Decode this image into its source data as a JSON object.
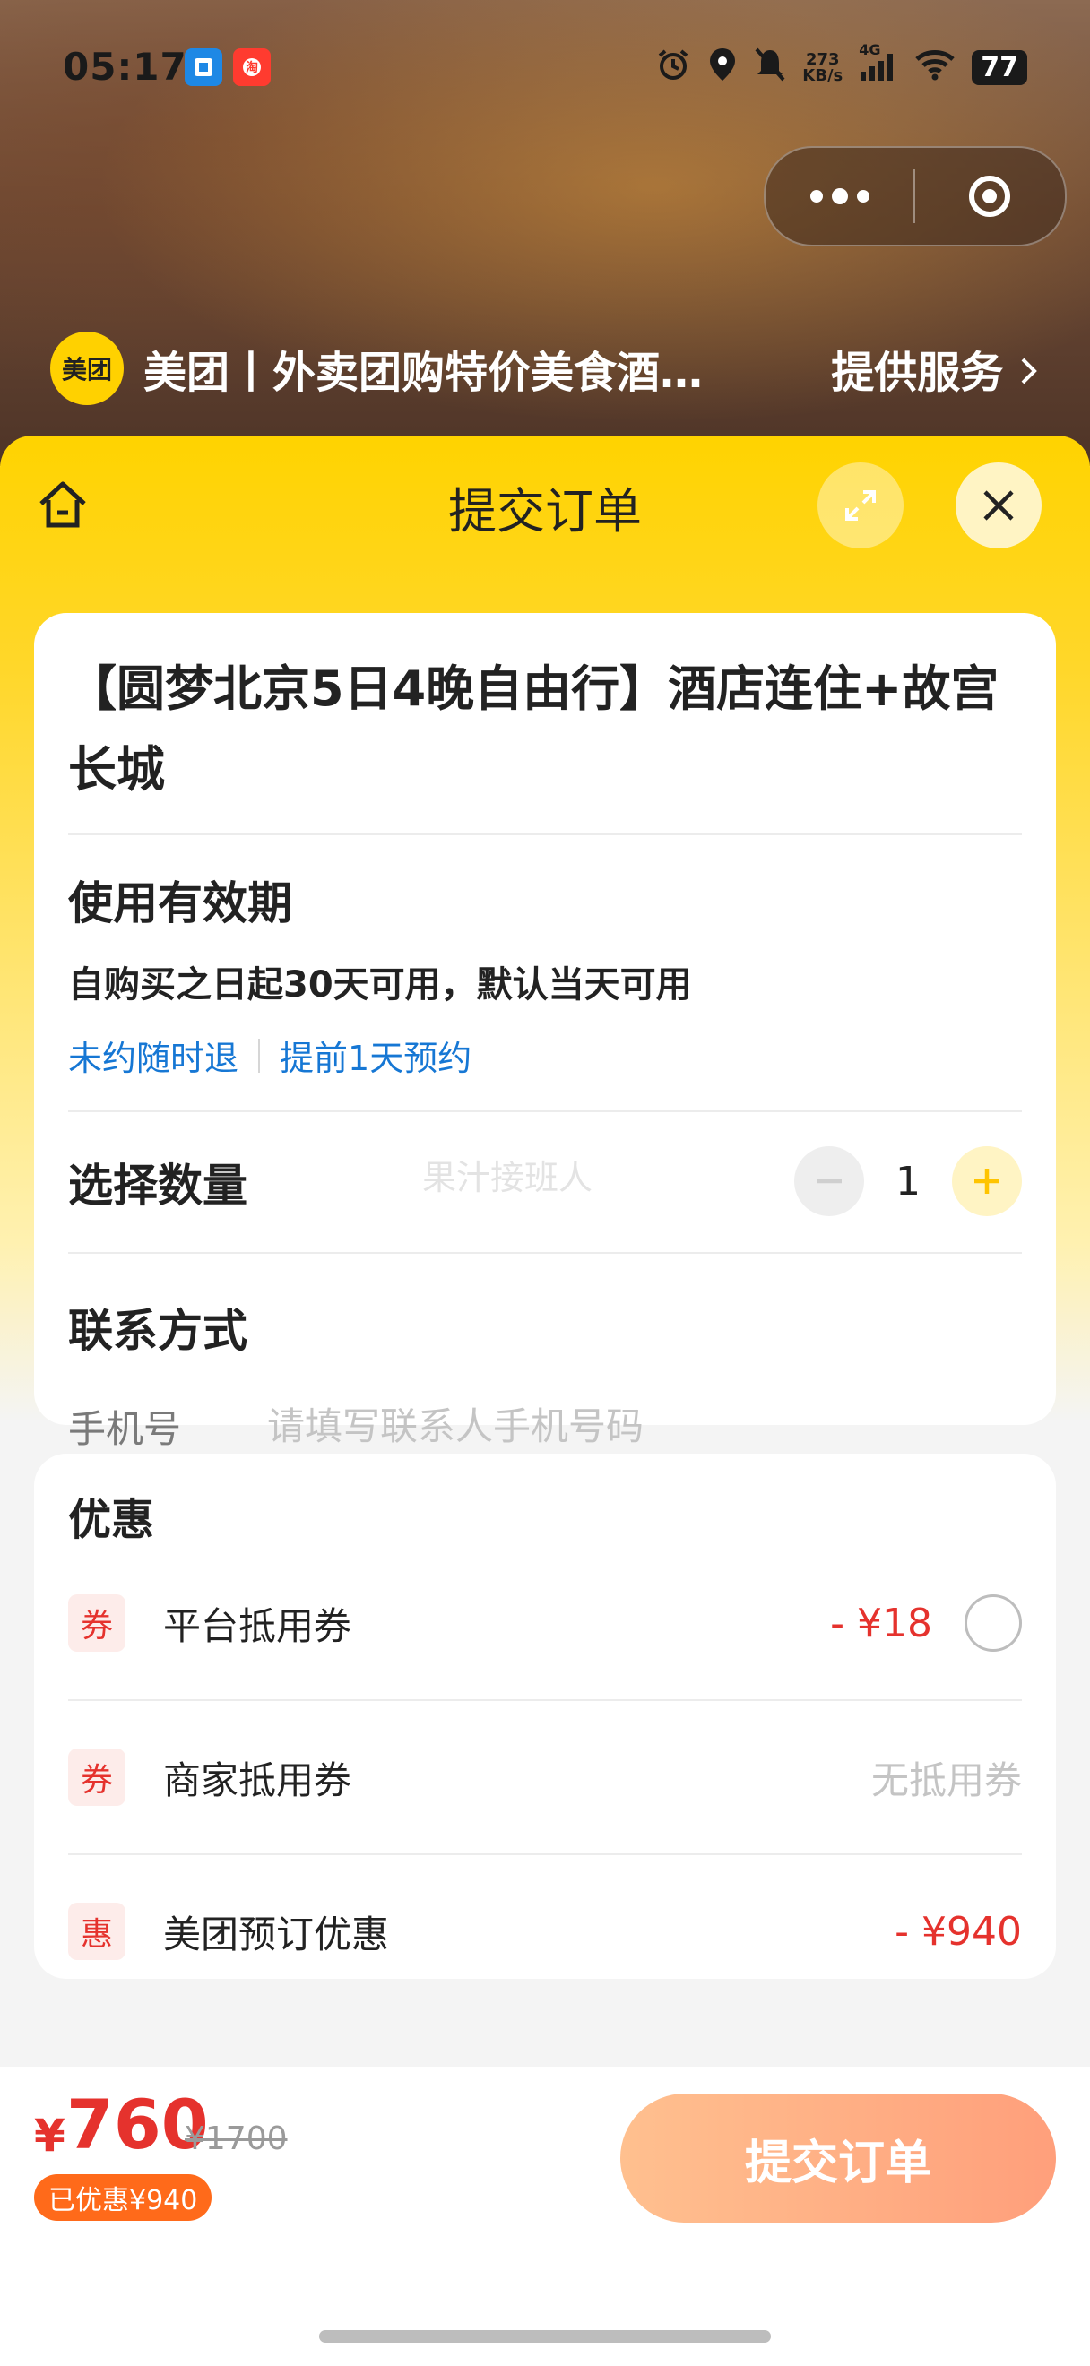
{
  "status_bar": {
    "time": "05:17",
    "net_speed_value": "273",
    "net_speed_unit": "KB/s",
    "network": "4G",
    "battery": "77"
  },
  "mini_program": {
    "provider_logo_text": "美团",
    "provider_name": "美团丨外卖团购特价美食酒…",
    "service_link": "提供服务"
  },
  "sheet": {
    "title": "提交订单",
    "product_title": "【圆梦北京5日4晚自由行】酒店连住+故宫长城",
    "validity": {
      "label": "使用有效期",
      "text": "自购买之日起30天可用，默认当天可用",
      "tags": [
        "未约随时退",
        "提前1天预约"
      ]
    },
    "quantity": {
      "label": "选择数量",
      "value": "1",
      "watermark": "果汁接班人"
    },
    "contact": {
      "label": "联系方式",
      "phone_label": "手机号",
      "phone_placeholder": "请填写联系人手机号码",
      "phone_value": ""
    },
    "discounts": {
      "title": "优惠",
      "items": [
        {
          "icon_text": "券",
          "name": "平台抵用券",
          "amount": "- ¥18"
        },
        {
          "icon_text": "券",
          "name": "商家抵用券",
          "amount": "无抵用券"
        },
        {
          "icon_text": "惠",
          "name": "美团预订优惠",
          "amount": "- ¥940"
        }
      ]
    }
  },
  "footer": {
    "currency": "¥",
    "price": "760",
    "original_price": "¥1700",
    "saved_badge": "已优惠¥940",
    "submit_label": "提交订单"
  },
  "colors": {
    "brand_yellow": "#ffd300",
    "price_red": "#e5322d",
    "link_blue": "#1677d4",
    "badge_orange": "#ff6a1a"
  }
}
